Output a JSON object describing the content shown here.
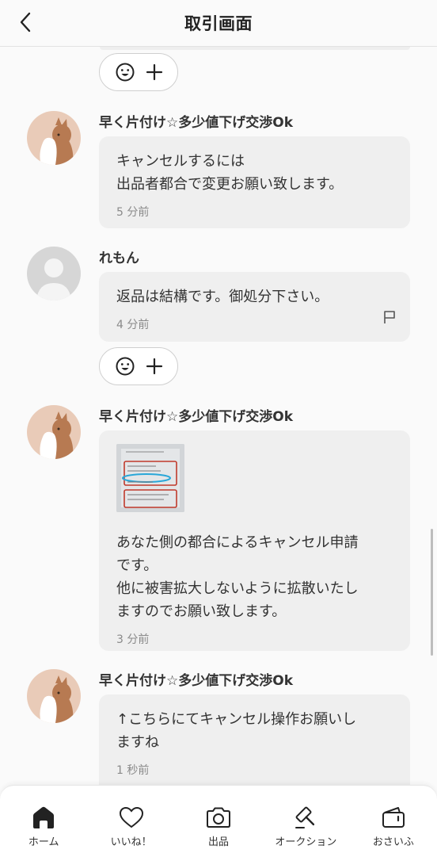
{
  "header": {
    "title": "取引画面",
    "back_icon": "chevron-left-icon"
  },
  "reaction": {
    "emoji_icon": "smiley-icon",
    "add_icon": "plus-icon"
  },
  "messages": [
    {
      "user": "早く片付け☆多少値下げ交渉Ok",
      "avatar": "cat-avatar",
      "text": "キャンセルするには\n出品者都合で変更お願い致します。",
      "time": "5 分前"
    },
    {
      "user": "れもん",
      "avatar": "default-avatar",
      "text": "返品は結構です。御処分下さい。",
      "time": "4 分前",
      "flag_icon": "flag-icon"
    },
    {
      "user": "早く片付け☆多少値下げ交渉Ok",
      "avatar": "cat-avatar",
      "has_image": true,
      "text": "あなた側の都合によるキャンセル申請\nです。\n他に被害拡大しないように拡散いたし\nますのでお願い致します。",
      "time": "3 分前"
    },
    {
      "user": "早く片付け☆多少値下げ交渉Ok",
      "avatar": "cat-avatar",
      "text": "↑こちらにてキャンセル操作お願いし\nますね",
      "time": "1 秒前"
    }
  ],
  "tabbar": {
    "items": [
      {
        "label": "ホーム",
        "icon": "home-icon"
      },
      {
        "label": "いいね！",
        "icon": "heart-icon"
      },
      {
        "label": "出品",
        "icon": "camera-icon"
      },
      {
        "label": "オークション",
        "icon": "gavel-icon"
      },
      {
        "label": "おさいふ",
        "icon": "wallet-icon"
      }
    ]
  }
}
